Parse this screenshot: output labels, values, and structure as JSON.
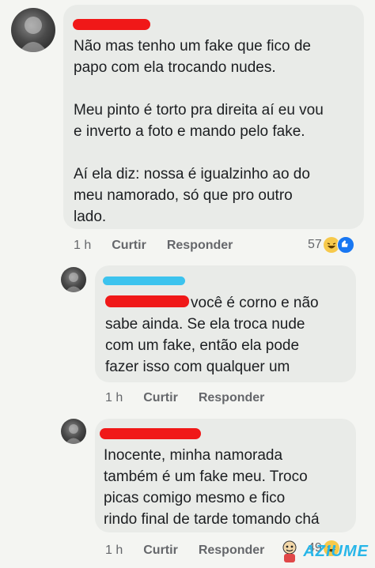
{
  "comments": [
    {
      "text": "Não mas tenho um fake que fico de\npapo com ela trocando nudes.\n\nMeu pinto é torto pra direita aí eu vou\ne inverto a foto e mando pelo fake.\n\nAí ela diz: nossa é igualzinho ao do\nmeu namorado, só que pro outro\nlado.",
      "time": "1 h",
      "like_label": "Curtir",
      "reply_label": "Responder",
      "reaction_count": "57",
      "reaction_icons": [
        "haha-emoji-icon",
        "like-icon"
      ]
    },
    {
      "text": "você é corno e não\nsabe ainda. Se ela troca nude\ncom um fake, então ela pode\nfazer isso com qualquer um",
      "time": "1 h",
      "like_label": "Curtir",
      "reply_label": "Responder"
    },
    {
      "text": "Inocente, minha namorada\ntambém é um fake meu. Troco\npicas comigo mesmo e fico\nrindo final de tarde tomando chá",
      "time": "1 h",
      "like_label": "Curtir",
      "reply_label": "Responder",
      "reaction_count": "49",
      "reaction_icons": [
        "haha-emoji-icon",
        "like-icon"
      ]
    }
  ],
  "watermark": {
    "text": "AZIUME"
  },
  "colors": {
    "redaction": "#f01818",
    "redaction_blue": "#3cc3ee",
    "bubble": "#e9ebe8",
    "accent": "#1877f2"
  }
}
